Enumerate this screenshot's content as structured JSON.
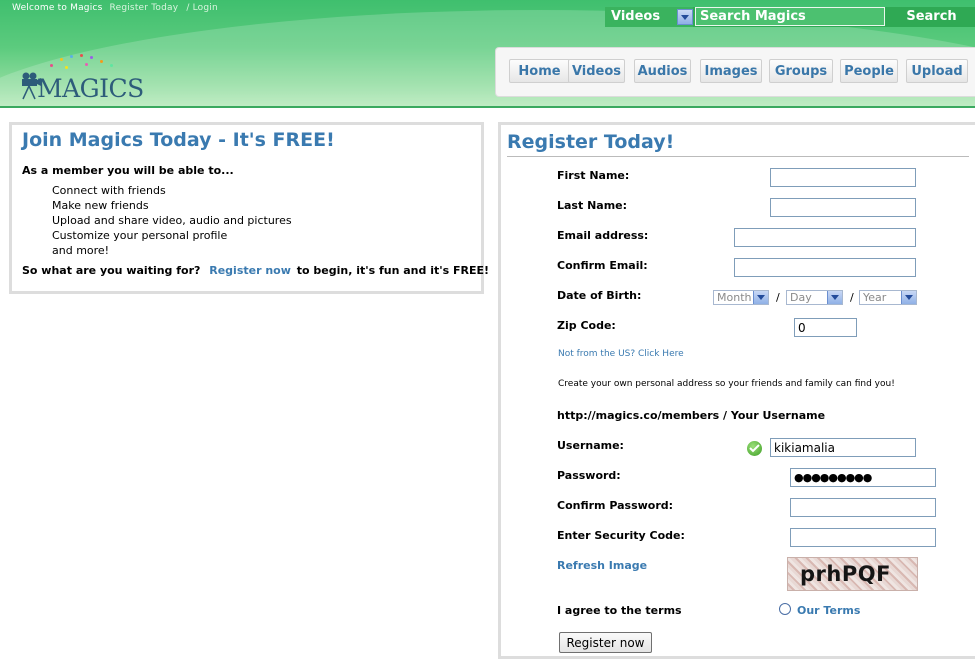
{
  "header": {
    "welcome_text": "Welcome  to Magics",
    "register_link": "Register Today",
    "separator": "/",
    "login_link": "Login",
    "logo_text": "MAGICS"
  },
  "search": {
    "category": "Videos",
    "placeholder": "Search Magics",
    "button": "Search"
  },
  "nav": {
    "tabs": [
      "Home",
      "Videos",
      "Audios",
      "Images",
      "Groups",
      "People",
      "Upload"
    ]
  },
  "join": {
    "title": "Join Magics Today - It's FREE!",
    "intro": "As a member you will be able to...",
    "benefits": [
      "Connect with friends",
      "Make new friends",
      "Upload and share video, audio and pictures",
      "Customize your personal profile",
      "and more!"
    ],
    "cta_before": "So what are you waiting for?",
    "cta_link": "Register now",
    "cta_after": "to begin, it's fun and it's FREE!"
  },
  "register": {
    "title": "Register Today!",
    "labels": {
      "first_name": "First Name:",
      "last_name": "Last Name:",
      "email": "Email address:",
      "confirm_email": "Confirm Email:",
      "dob": "Date of Birth:",
      "zip": "Zip Code:",
      "url": "http://magics.co/members / Your Username",
      "username": "Username:",
      "password": "Password:",
      "confirm_password": "Confirm Password:",
      "security_code": "Enter Security Code:",
      "agree": "I agree to the terms"
    },
    "dob_month": "Month",
    "dob_day": "Day",
    "dob_year": "Year",
    "dob_separator": "/",
    "zip_value": "0",
    "not_us_link": "Not from the US? Click Here",
    "address_note": "Create your own personal address so your friends and family can find you!",
    "username_value": "kikiamalia",
    "password_value": "●●●●●●●●●",
    "refresh_link": "Refresh Image",
    "captcha_text": "prhPQF",
    "terms_link": "Our Terms",
    "submit": "Register now"
  }
}
